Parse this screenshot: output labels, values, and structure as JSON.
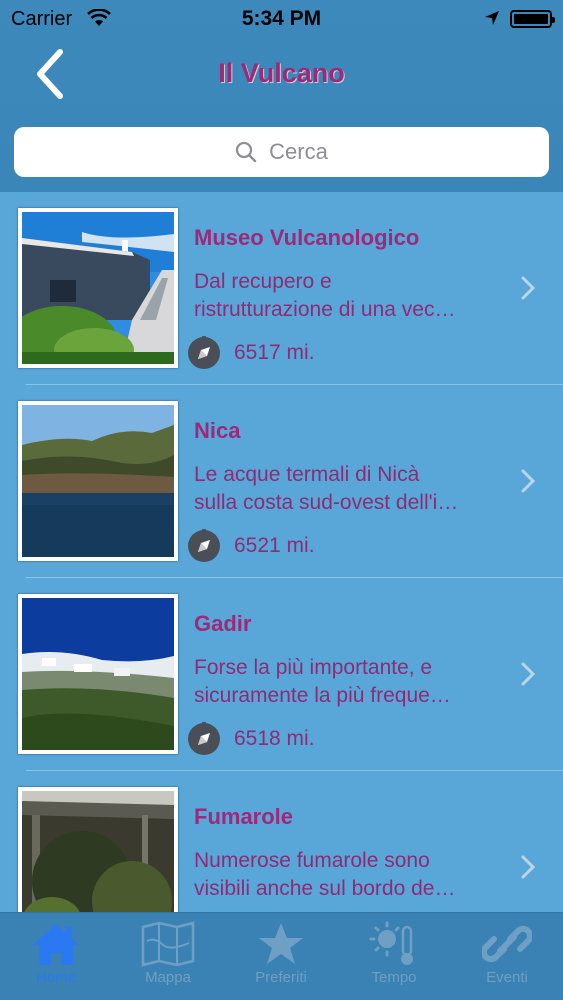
{
  "status_bar": {
    "carrier": "Carrier",
    "time": "5:34 PM"
  },
  "nav": {
    "title": "Il Vulcano",
    "back_icon": "chevron-left-icon"
  },
  "search": {
    "placeholder": "Cerca"
  },
  "items": [
    {
      "title": "Museo Vulcanologico",
      "desc_line1": "Dal recupero e",
      "desc_line2": "ristrutturazione di una vec…",
      "distance": "6517 mi."
    },
    {
      "title": "Nica",
      "desc_line1": "Le acque termali di Nicà",
      "desc_line2": "sulla costa sud-ovest dell'i…",
      "distance": "6521 mi."
    },
    {
      "title": "Gadir",
      "desc_line1": "Forse la più importante, e",
      "desc_line2": "sicuramente la più freque…",
      "distance": "6518 mi."
    },
    {
      "title": "Fumarole",
      "desc_line1": "Numerose fumarole sono",
      "desc_line2": "visibili anche sul bordo de…",
      "distance": ""
    }
  ],
  "tabs": [
    {
      "label": "Home",
      "icon": "home-icon",
      "active": true
    },
    {
      "label": "Mappa",
      "icon": "map-icon",
      "active": false
    },
    {
      "label": "Preferiti",
      "icon": "star-icon",
      "active": false
    },
    {
      "label": "Tempo",
      "icon": "weather-icon",
      "active": false
    },
    {
      "label": "Eventi",
      "icon": "link-icon",
      "active": false
    }
  ],
  "colors": {
    "accent": "#9c2a79",
    "header": "#3d89bb",
    "list_bg": "#59a7d8",
    "tab_active": "#2a78f2"
  }
}
